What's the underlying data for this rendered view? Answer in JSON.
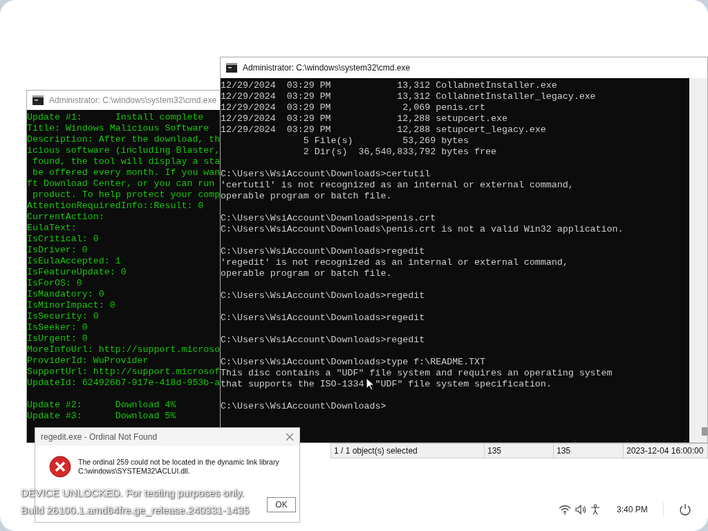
{
  "consoles": [
    {
      "title": "Administrator: C:\\windows\\system32\\cmd.exe",
      "active": false,
      "color": "#16c60c",
      "blocks": [
        [
          "Update #1:      Install complete",
          "Title: Windows Malicious Software",
          "Description: After the download, th",
          "icious software (including Blaster,",
          " found, the tool will display a sta",
          " be offered every month. If you wan",
          "ft Download Center, or you can run",
          " product. To help protect your comp",
          "AttentionRequiredInfo::Result: 0",
          "CurrentAction:",
          "EulaText:",
          "IsCritical: 0",
          "IsDriver: 0",
          "IsEulaAccepted: 1",
          "IsFeatureUpdate: 0",
          "IsForOS: 0",
          "IsMandatory: 0",
          "IsMinorImpact: 0",
          "IsSecurity: 0",
          "IsSeeker: 0",
          "IsUrgent: 0",
          "MoreInfoUrl: http://support.microso",
          "ProviderId: WuProvider",
          "SupportUrl: http://support.microsof",
          "UpdateId: 624926b7-917e-418d-953b-a"
        ],
        [
          "Update #2:      Download 4%",
          "Update #3:      Download 5%"
        ]
      ]
    },
    {
      "title": "Administrator: C:\\windows\\system32\\cmd.exe",
      "active": true,
      "color": "#cccccc",
      "blocks": [
        [
          "12/29/2024  03:29 PM            13,312 CollabnetInstaller.exe",
          "12/29/2024  03:29 PM            13,312 CollabnetInstaller_legacy.exe",
          "12/29/2024  03:29 PM             2,069 penis.crt",
          "12/29/2024  03:29 PM            12,288 setupcert.exe",
          "12/29/2024  03:29 PM            12,288 setupcert_legacy.exe",
          "               5 File(s)         53,269 bytes",
          "               2 Dir(s)  36,540,833,792 bytes free"
        ],
        [
          "C:\\Users\\WsiAccount\\Downloads>certutil",
          "'certutil' is not recognized as an internal or external command,",
          "operable program or batch file."
        ],
        [
          "C:\\Users\\WsiAccount\\Downloads>penis.crt",
          "C:\\Users\\WsiAccount\\Downloads\\penis.crt is not a valid Win32 application."
        ],
        [
          "C:\\Users\\WsiAccount\\Downloads>regedit",
          "'regedit' is not recognized as an internal or external command,",
          "operable program or batch file."
        ],
        [
          "C:\\Users\\WsiAccount\\Downloads>regedit"
        ],
        [
          "C:\\Users\\WsiAccount\\Downloads>regedit"
        ],
        [
          "C:\\Users\\WsiAccount\\Downloads>regedit"
        ],
        [
          "C:\\Users\\WsiAccount\\Downloads>type f:\\README.TXT",
          "This disc contains a \"UDF\" file system and requires an operating system",
          [
            "that supports the ISO-1334",
            "\"UDF\" file system specification."
          ]
        ],
        [
          "C:\\Users\\WsiAccount\\Downloads>"
        ]
      ]
    }
  ],
  "status_bar": {
    "cells": [
      "1 / 1 object(s) selected",
      "135",
      "135",
      "2023-12-04 16:00:00"
    ]
  },
  "dialog": {
    "title": "regedit.exe - Ordinal Not Found",
    "message": "The ordinal 259 could not be located in the dynamic link library C:\\windows\\SYSTEM32\\ACLUI.dll.",
    "buttons": [
      "OK"
    ]
  },
  "watermark": [
    "DEVICE UNLOCKED. For testing purposes only.",
    "Build 26100.1.amd64fre.ge_release.240331-1435"
  ],
  "tray": {
    "clock": "3:40 PM"
  }
}
